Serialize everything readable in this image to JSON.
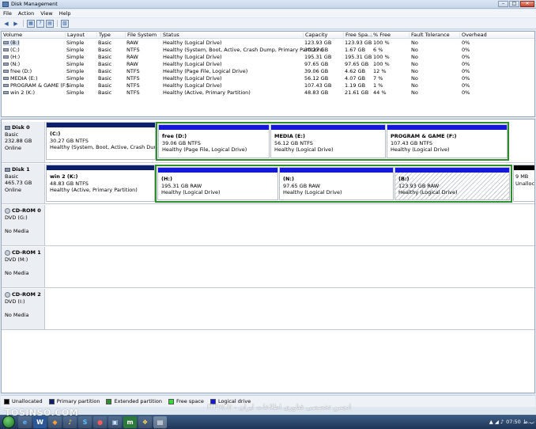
{
  "window": {
    "title": "Disk Management",
    "btn_min": "–",
    "btn_max": "□",
    "btn_close": "✕"
  },
  "menu": [
    "File",
    "Action",
    "View",
    "Help"
  ],
  "toolbar": {
    "back": "◀",
    "forward": "▶",
    "t1": "▦",
    "t2": "?",
    "t3": "▤",
    "t4": "▧"
  },
  "volume_list": {
    "columns": [
      "Volume",
      "Layout",
      "Type",
      "File System",
      "Status",
      "Capacity",
      "Free Spa...",
      "% Free",
      "Fault Tolerance",
      "Overhead"
    ],
    "rows": [
      [
        "(B:)",
        "Simple",
        "Basic",
        "RAW",
        "Healthy (Logical Drive)",
        "123.93 GB",
        "123.93 GB",
        "100 %",
        "No",
        "0%"
      ],
      [
        "(C:)",
        "Simple",
        "Basic",
        "NTFS",
        "Healthy (System, Boot, Active, Crash Dump, Primary Partition)",
        "30.27 GB",
        "1.67 GB",
        "6 %",
        "No",
        "0%"
      ],
      [
        "(H:)",
        "Simple",
        "Basic",
        "RAW",
        "Healthy (Logical Drive)",
        "195.31 GB",
        "195.31 GB",
        "100 %",
        "No",
        "0%"
      ],
      [
        "(N:)",
        "Simple",
        "Basic",
        "RAW",
        "Healthy (Logical Drive)",
        "97.65 GB",
        "97.65 GB",
        "100 %",
        "No",
        "0%"
      ],
      [
        "free (D:)",
        "Simple",
        "Basic",
        "NTFS",
        "Healthy (Page File, Logical Drive)",
        "39.06 GB",
        "4.62 GB",
        "12 %",
        "No",
        "0%"
      ],
      [
        "MEDIA (E:)",
        "Simple",
        "Basic",
        "NTFS",
        "Healthy (Logical Drive)",
        "56.12 GB",
        "4.07 GB",
        "7 %",
        "No",
        "0%"
      ],
      [
        "PROGRAM & GAME (F:)",
        "Simple",
        "Basic",
        "NTFS",
        "Healthy (Logical Drive)",
        "107.43 GB",
        "1.19 GB",
        "1 %",
        "No",
        "0%"
      ],
      [
        "win 2 (K:)",
        "Simple",
        "Basic",
        "NTFS",
        "Healthy (Active, Primary Partition)",
        "48.83 GB",
        "21.61 GB",
        "44 %",
        "No",
        "0%"
      ]
    ]
  },
  "disks": {
    "disk0": {
      "name": "Disk 0",
      "type": "Basic",
      "size": "232.88 GB",
      "status": "Online",
      "parts": [
        {
          "name": "(C:)",
          "size": "30.27 GB NTFS",
          "status": "Healthy (System, Boot, Active, Crash Dump, Pri"
        },
        {
          "name": "free  (D:)",
          "size": "39.06 GB NTFS",
          "status": "Healthy (Page File, Logical Drive)"
        },
        {
          "name": "MEDIA  (E:)",
          "size": "56.12 GB NTFS",
          "status": "Healthy (Logical Drive)"
        },
        {
          "name": "PROGRAM & GAME  (F:)",
          "size": "107.43 GB NTFS",
          "status": "Healthy (Logical Drive)"
        }
      ]
    },
    "disk1": {
      "name": "Disk 1",
      "type": "Basic",
      "size": "465.73 GB",
      "status": "Online",
      "parts": [
        {
          "name": "win 2  (K:)",
          "size": "48.83 GB NTFS",
          "status": "Healthy (Active, Primary Partition)"
        },
        {
          "name": "(H:)",
          "size": "195.31 GB RAW",
          "status": "Healthy (Logical Drive)"
        },
        {
          "name": "(N:)",
          "size": "97.65 GB RAW",
          "status": "Healthy (Logical Drive)"
        },
        {
          "name": "(B:)",
          "size": "123.93 GB RAW",
          "status": "Healthy (Logical Drive)"
        },
        {
          "name": "",
          "size": "9 MB",
          "status": "Unalloc"
        }
      ]
    },
    "cdrom0": {
      "name": "CD-ROM 0",
      "type": "DVD (G:)",
      "status": "No Media"
    },
    "cdrom1": {
      "name": "CD-ROM 1",
      "type": "DVD (M:)",
      "status": "No Media"
    },
    "cdrom2": {
      "name": "CD-ROM 2",
      "type": "DVD (I:)",
      "status": "No Media"
    }
  },
  "legend": [
    {
      "label": "Unallocated",
      "color": "#000000"
    },
    {
      "label": "Primary partition",
      "color": "#0b1f6e"
    },
    {
      "label": "Extended partition",
      "color": "#2d8f2d"
    },
    {
      "label": "Free space",
      "color": "#33dd33"
    },
    {
      "label": "Logical drive",
      "color": "#1418d8"
    }
  ],
  "watermarks": {
    "left": "TOSINSO.COM",
    "right": "ITPro.ir - انجمن تخصصی فناوری اطلاعات ایران"
  },
  "taskbar": {
    "apps": [
      "e",
      "W",
      "◆",
      "♪",
      "S",
      "●",
      "▣",
      "m",
      "❖",
      "▤"
    ],
    "clock": "07:50",
    "date": "ب.ظ",
    "tray_icons": "▲ ◢ ♪"
  }
}
